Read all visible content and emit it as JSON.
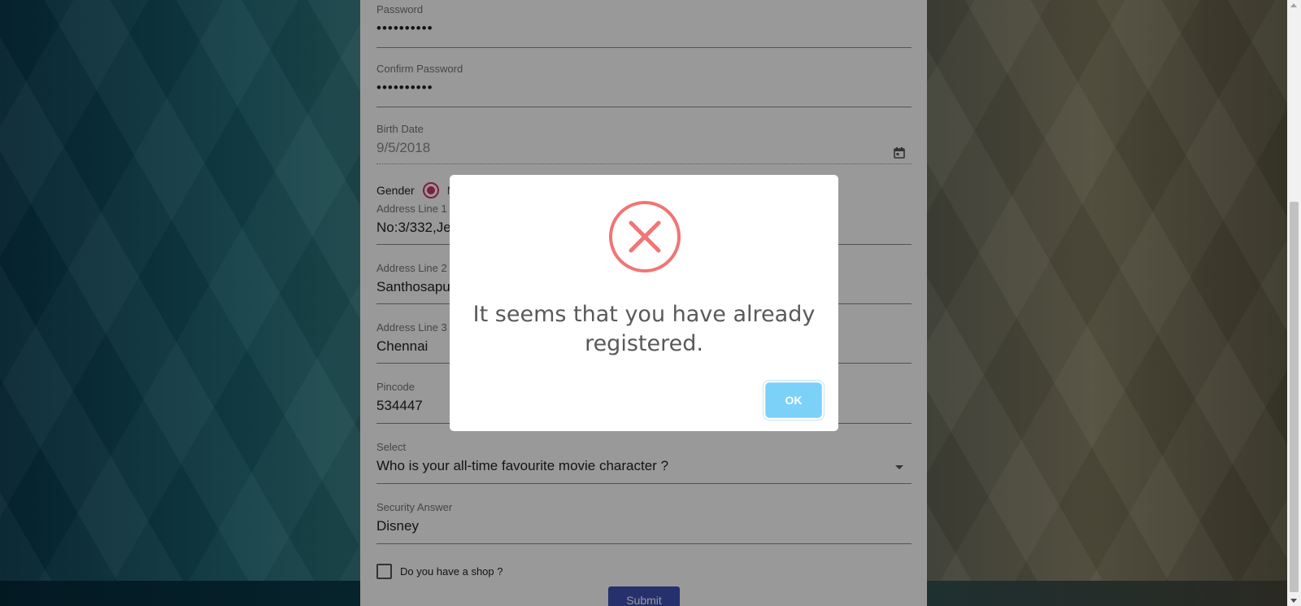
{
  "form": {
    "password": {
      "label": "Password",
      "value": "••••••••••"
    },
    "confirm_password": {
      "label": "Confirm Password",
      "value": "••••••••••"
    },
    "birth_date": {
      "label": "Birth Date",
      "value": "9/5/2018",
      "icon": "calendar-icon"
    },
    "gender": {
      "label": "Gender",
      "selected_partial": "M"
    },
    "address1": {
      "label": "Address Line 1",
      "value": "No:3/332,Je"
    },
    "address2": {
      "label": "Address Line 2",
      "value": "Santhosapu"
    },
    "address3": {
      "label": "Address Line 3",
      "value": "Chennai"
    },
    "pincode": {
      "label": "Pincode",
      "value": "534447"
    },
    "security_question": {
      "label": "Select",
      "value": "Who is your all-time favourite movie character ?"
    },
    "security_answer": {
      "label": "Security Answer",
      "value": "Disney"
    },
    "shop_checkbox": {
      "label": "Do you have a shop ?",
      "checked": false
    },
    "submit_label": "Submit"
  },
  "dialog": {
    "icon": "error-x-icon",
    "title": "It seems that you have already registered.",
    "ok_label": "OK",
    "colors": {
      "error": "#f27474",
      "ok_button": "#7cd1f9"
    }
  },
  "theme": {
    "accent": "#3f51b5",
    "radio": "#d0336b"
  }
}
